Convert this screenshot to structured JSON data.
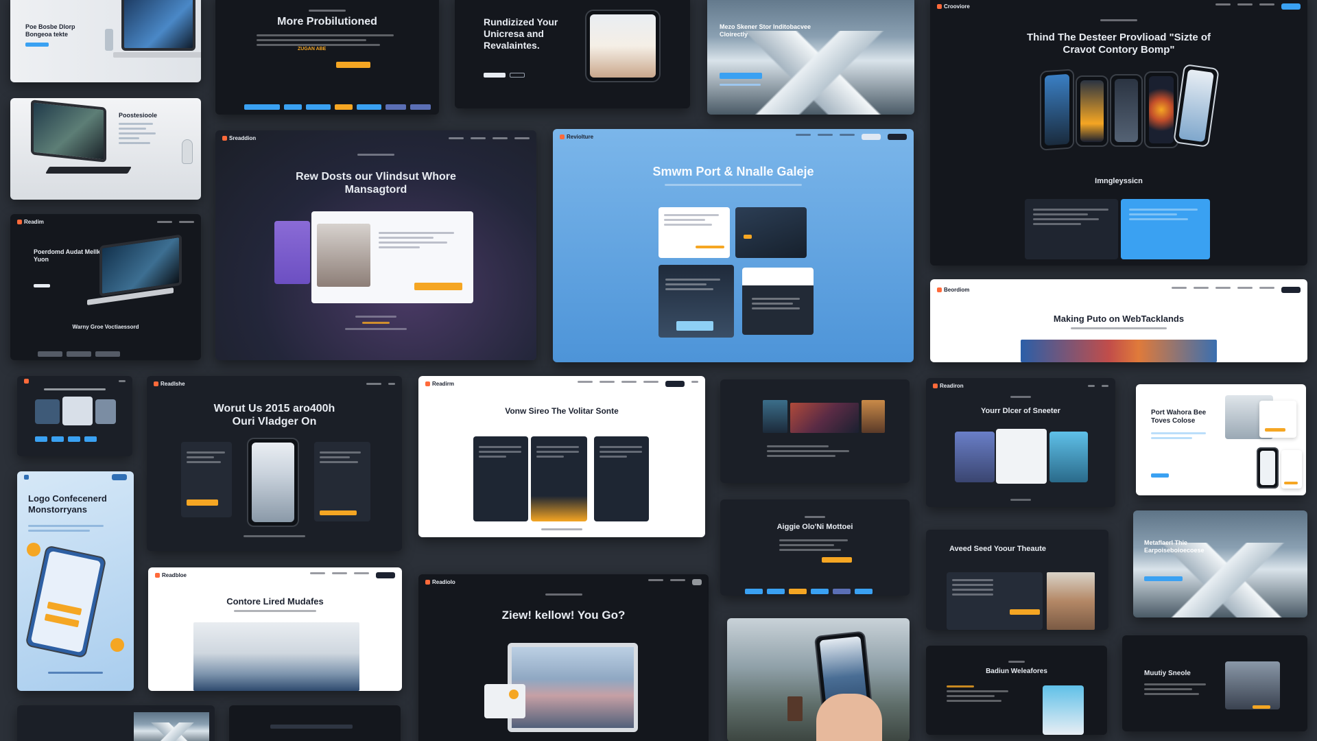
{
  "tiles": {
    "t1": {
      "title": "Poe Bosbe Dlorp Bongeoa tekte"
    },
    "t2": {
      "title": "More Probilutioned",
      "cta": "ZUGAN ABE"
    },
    "t3": {
      "title": "Rundizized Your Unicresa and Revalaintes."
    },
    "t4": {
      "title": "Mezo Skener Stor Inditobacvee Cloirectly"
    },
    "t5": {
      "title": "Thind The Desteer Provlioad \"Sizte of Cravot Contory Bomp\"",
      "subtitle": "Imngleyssicn"
    },
    "t6": {
      "title": "Poostesioole"
    },
    "t7": {
      "brand": "Sreaddion",
      "title": "Rew Dosts our Vlindsut Whore Mansagtord"
    },
    "t8": {
      "brand": "Reviolture",
      "title": "Smwm Port & Nnalle Galeje"
    },
    "t9": {
      "brand": "Readim",
      "title": "Poerdomd Audat Mellk Yuon",
      "footer": "Warny Groe Voctiaessord"
    },
    "t10": {
      "brand": "Beordiom",
      "title": "Making Puto on WebTacklands"
    },
    "t11": {
      "title": "Worut Us 2015 aro400h Ouri Vladger On",
      "brand": "Readlshe"
    },
    "t12": {
      "brand": "Readirm",
      "title": "Vonw Sireo The Volitar Sonte"
    },
    "t13": {
      "brand": "Readiron",
      "title": "Yourr Dlcer of Sneeter"
    },
    "t14": {
      "title": "Port Wahora Bee Toves Colose"
    },
    "t15": {
      "title": "Logo Confecenerd Monstorryans"
    },
    "t16": {
      "brand": "Readbloe",
      "title": "Contore Lired Mudafes"
    },
    "t17": {
      "title": "Aiggie Olo'Ni Mottoei"
    },
    "t18": {
      "title": "Aveed Seed Yoour Theaute"
    },
    "t19": {
      "title": "Metaflaerl Thie Earpoiseboioecoese"
    },
    "t20": {
      "brand": "Readiolo",
      "title": "Ziew! kellow! You Go?"
    },
    "t21": {
      "title": "Badiun Weleafores"
    },
    "t22": {
      "title": "Muutiy Sneole"
    }
  },
  "colors": {
    "accent": "#f5a623",
    "link": "#3aa1f2",
    "brand": "#ff6a3a"
  }
}
